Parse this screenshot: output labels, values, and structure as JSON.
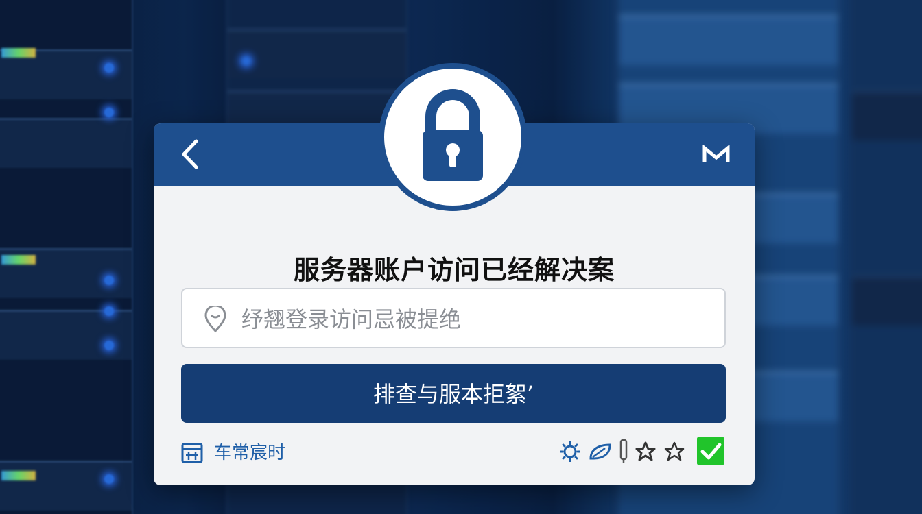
{
  "dialog": {
    "title": "服务器账户访问已经解决案",
    "input": {
      "value": "纾翘登录访问忌被提绝"
    },
    "primary_button_label": "排查与服本拒絮’",
    "footer": {
      "link_label": "车常宸时"
    },
    "icons": {
      "back": "chevron-left-icon",
      "menu": "m-logo-icon",
      "badge": "padlock-icon",
      "input": "map-pin-icon",
      "footer_link": "calendar-icon",
      "footer_row": [
        "sun-icon",
        "leaf-icon",
        "pen-icon",
        "star-filled-icon",
        "star-outline-icon",
        "checkbox-checked-icon"
      ]
    },
    "colors": {
      "header": "#1e4f8e",
      "button": "#153d74",
      "accent_link": "#1f5fa8",
      "check": "#21c42b"
    }
  }
}
